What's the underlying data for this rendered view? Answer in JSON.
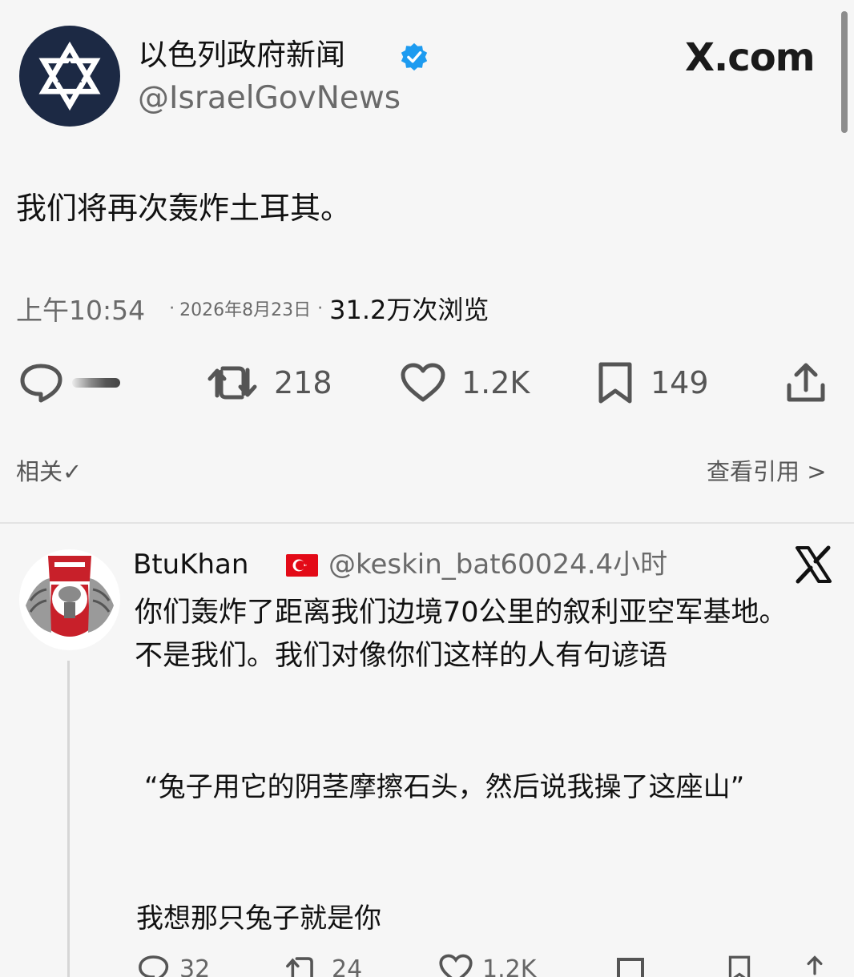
{
  "tweet": {
    "display_name": "以色列政府新闻",
    "handle": "@IsraelGovNews",
    "verified_icon": "verified-badge-icon",
    "site_brand": "X.com",
    "text": "我们将再次轰炸土耳其。",
    "time": "上午10:54",
    "date_sep": "·",
    "date": "2026年8月23日",
    "views_sep": "·",
    "views": "31.2万次浏览",
    "actions": {
      "reply_icon": "comment-icon",
      "retweet_icon": "retweet-icon",
      "retweet_count": "218",
      "like_icon": "heart-icon",
      "like_count": "1.2K",
      "bookmark_icon": "bookmark-icon",
      "bookmark_count": "149",
      "share_icon": "share-icon"
    },
    "related_label": "相关✓",
    "view_quotes_label": "查看引用 >"
  },
  "reply": {
    "display_name": "BtuKhan",
    "flag_icon": "turkey-flag-icon",
    "handle_time": "@keskin_bat60024.4小时",
    "body": "你们轰炸了距离我们边境70公里的叙利亚空军基地。不是我们。我们对像你们这样的人有句谚语",
    "quote": "“兔子用它的阴茎摩擦石头，然后说我操了这座山”",
    "last_line": "我想那只兔子就是你",
    "actions": {
      "reply_count": "32",
      "retweet_count": "24",
      "like_count": "1.2K"
    }
  },
  "colors": {
    "background": "#f6f6f6",
    "verified": "#1d9bf0",
    "avatar_navy": "#1c2944",
    "flag_red": "#e30a17"
  }
}
